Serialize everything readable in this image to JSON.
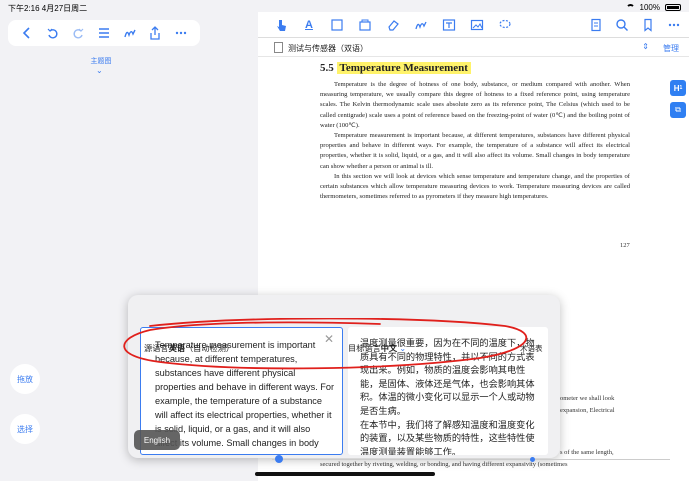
{
  "status_bar": {
    "time_date": "下午2:16   4月27日周二",
    "battery": "100%"
  },
  "left_toolbar": {
    "icons": [
      "chevron-left-icon",
      "undo-icon",
      "redo-icon",
      "list-icon",
      "pen-icon",
      "share-icon",
      "more-icon"
    ]
  },
  "outline": {
    "label": "主题图"
  },
  "side_buttons": {
    "drag": "拖放",
    "select": "选择"
  },
  "doc_tab": {
    "title": "测试与传感器（双语）",
    "manage": "管理"
  },
  "page": {
    "section_number": "5.5",
    "title": "Temperature Measurement",
    "paragraphs": [
      "Temperature is the degree of hotness of one body, substance, or medium compared with another. When measuring temperature, we usually compare this degree of hotness to a fixed reference point, using temperature scales. The Kelvin thermodynamic scale uses absolute zero as its reference point, The Celsius (which used to be called centigrade) scale uses a point of reference based on the freezing-point of water (0℃) and the boiling point of water (100℃).",
      "Temperature measurement is important because, at different temperatures, substances have different physical properties and behave in different ways. For example, the temperature of a substance will affect its electrical properties, whether it is solid, liquid, or a gas, and it will also affect its volume. Small changes in body temperature can show whether a person or animal is ill.",
      "In this section we will look at devices which sense temperature and temperature change, and the properties of certain substances which allow temperature measuring devices to work. Temperature measuring devices are called thermometers, sometimes referred to as pyrometers if they measure high temperatures."
    ],
    "page_number": "127",
    "fragment_1": "ometer we shall look",
    "fragment_2": "expansion, Electrical",
    "fragment_3": "s of the same length,",
    "bottom_line": "secured together by riveting, welding, or bonding, and having different expansivity (sometimes"
  },
  "translation": {
    "source_prefix": "源语言",
    "source_lang": "英语",
    "source_detect": "（自动检测）",
    "target_prefix": "目标语言",
    "target_lang": "中文",
    "term_label": "术语表",
    "source_text": "Temperature measurement is important because, at different temperatures, substances have different physical properties and behave in different ways. For example, the temperature of a substance will affect its electrical properties, whether it is solid, liquid, or a gas, and it will also affect its volume. Small changes in body temperature can",
    "target_p1": "温度测量很重要，因为在不同的温度下，物质具有不同的物理特性，并以不同的方式表现出来。例如，物质的温度会影响其电性能，是固体、液体还是气体，也会影响其体积。体温的微小变化可以显示一个人或动物是否生病。",
    "target_p2": "在本节中，我们将了解感知温度和温度变化的装置，以及某些物质的特性，这些特性使温度测量装置能够工作。",
    "english_chip": "English"
  },
  "colors": {
    "accent": "#3b7cf0",
    "highlight": "#fff36a",
    "annotation": "#e0201c"
  }
}
